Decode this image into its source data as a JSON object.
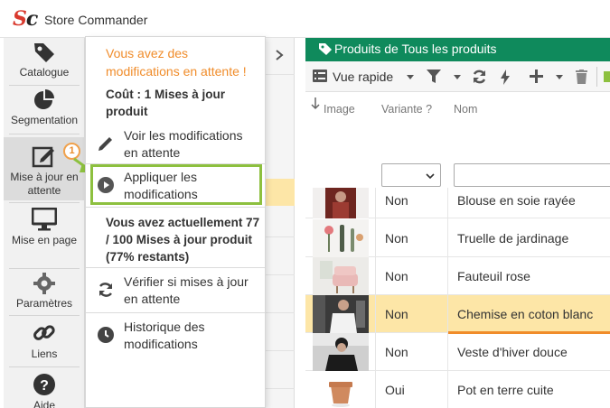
{
  "app": {
    "logo": "Sc",
    "title": "Store Commander"
  },
  "sidebar": {
    "items": [
      {
        "label": "Catalogue",
        "icon": "tag-icon"
      },
      {
        "label": "Segmentation",
        "icon": "pie-chart-icon"
      },
      {
        "label": "Mise à jour en attente",
        "icon": "edit-icon",
        "badge": "1"
      },
      {
        "label": "Mise en page",
        "icon": "monitor-icon"
      },
      {
        "label": "Paramètres",
        "icon": "gear-icon"
      },
      {
        "label": "Liens",
        "icon": "link-icon"
      },
      {
        "label": "Aide",
        "icon": "help-icon"
      }
    ]
  },
  "menu": {
    "warning": "Vous avez des modifications en attente !",
    "cost": "Coût : 1 Mises à jour produit",
    "items": [
      {
        "label": "Voir les modifications en attente",
        "icon": "pencil-icon"
      },
      {
        "label": "Appliquer les modifications",
        "icon": "play-icon"
      },
      {
        "label": "Vérifier si mises à jour en attente",
        "icon": "refresh-icon"
      },
      {
        "label": "Historique des modifications",
        "icon": "clock-icon"
      }
    ],
    "quota": "Vous avez actuellement 77 / 100 Mises à jour produit (77% restants)"
  },
  "panel": {
    "title": "Produits de Tous les produits",
    "toolbar": {
      "view_label": "Vue rapide"
    },
    "columns": {
      "image": "Image",
      "variant": "Variante ?",
      "name": "Nom"
    },
    "rows": [
      {
        "variant": "Non",
        "name": "Blouse en soie rayée"
      },
      {
        "variant": "Non",
        "name": "Truelle de jardinage"
      },
      {
        "variant": "Non",
        "name": "Fauteuil rose"
      },
      {
        "variant": "Non",
        "name": "Chemise en coton blanc",
        "selected": true
      },
      {
        "variant": "Non",
        "name": "Veste d'hiver douce"
      },
      {
        "variant": "Oui",
        "name": "Pot en terre cuite"
      }
    ]
  },
  "colors": {
    "header_green": "#0f8a5c",
    "warning_orange": "#f08c2a",
    "highlight_green": "#8dc03f",
    "selected_row": "#fde6a7"
  }
}
